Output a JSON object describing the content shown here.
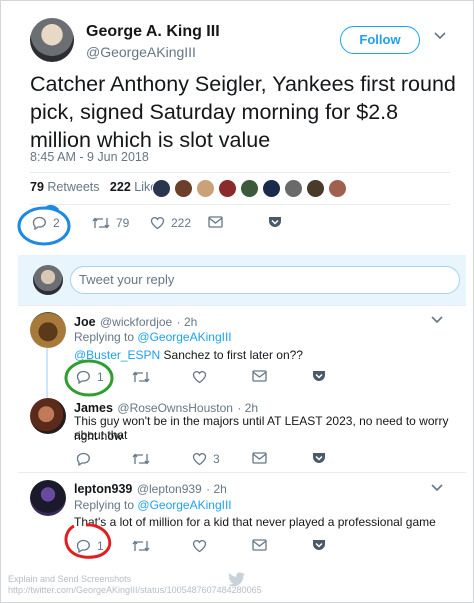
{
  "tweet": {
    "author_name": "George A. King III",
    "author_handle": "@GeorgeAKingIII",
    "follow_label": "Follow",
    "text": "Catcher Anthony Seigler, Yankees first round pick, signed Saturday morning for $2.8 million which is slot value",
    "timestamp": "8:45 AM - 9 Jun 2018",
    "retweets_count": "79",
    "retweets_label": "Retweets",
    "likes_count": "222",
    "likes_label": "Likes",
    "actions": {
      "reply": "2",
      "retweet": "79",
      "like": "222"
    }
  },
  "reply_box": {
    "placeholder": "Tweet your reply"
  },
  "replies": [
    {
      "name": "Joe",
      "handle": "@wickfordjoe",
      "time": "· 2h",
      "replying_prefix": "Replying to",
      "replying_to": "@GeorgeAKingIII",
      "mention": "@Buster_ESPN",
      "text": " Sanchez to first later on??",
      "reply_count": "1",
      "retweet_count": "",
      "like_count": ""
    },
    {
      "name": "James",
      "handle": "@RoseOwnsHouston",
      "time": "· 2h",
      "text_line1": "This guy won't be in the majors until AT LEAST 2023, no need to worry about that",
      "text_line2": "right now",
      "reply_count": "",
      "retweet_count": "",
      "like_count": "3"
    },
    {
      "name": "lepton939",
      "handle": "@lepton939",
      "time": "· 2h",
      "replying_prefix": "Replying to",
      "replying_to": "@GeorgeAKingIII",
      "text": "That's a lot of million for a kid that never played a professional game",
      "reply_count": "1",
      "retweet_count": "",
      "like_count": ""
    }
  ],
  "footer": {
    "line1": "Explain and Send Screenshots",
    "line2": "http://twitter.com/GeorgeAKingIII/status/1005487607484280065"
  },
  "colors": {
    "twitter_blue": "#1da1f2",
    "annotation_blue": "#1e88e5",
    "annotation_green": "#2e9e2e",
    "annotation_red": "#e02020"
  }
}
